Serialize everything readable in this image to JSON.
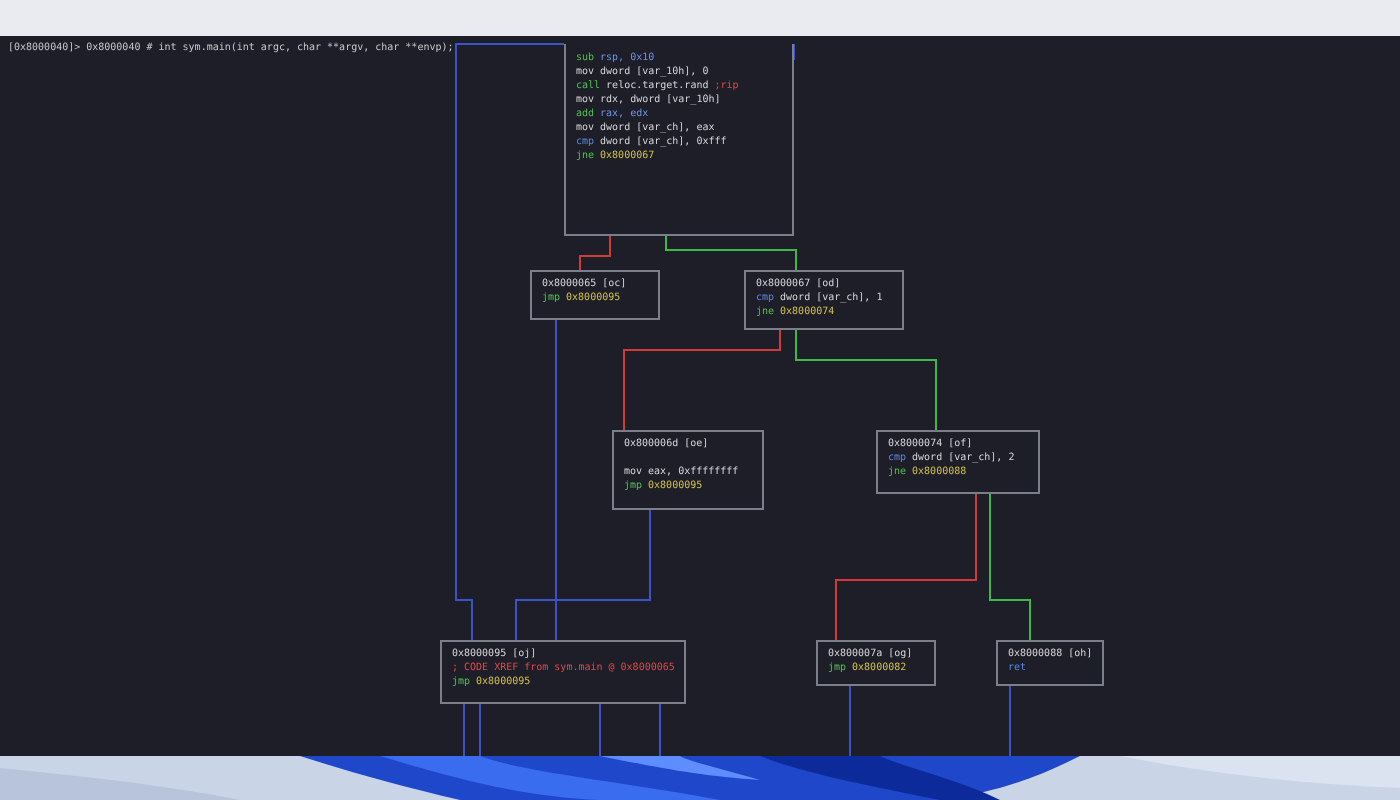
{
  "prompt": {
    "address": "[0x8000040]>",
    "text": "0x8000040 # int sym.main(int argc, char **argv, char **envp);"
  },
  "blocks": [
    {
      "lines": [
        {
          "kind": "arith",
          "op": "sub",
          "args": "rsp, 0x10"
        },
        {
          "kind": "mov",
          "op": "mov",
          "args": "dword [var_10h], 0"
        },
        {
          "kind": "call",
          "op": "call",
          "args": "reloc.target.rand",
          "note": ";rip"
        },
        {
          "kind": "mov",
          "op": "mov",
          "args": "rdx, dword [var_10h]"
        },
        {
          "kind": "arith",
          "op": "add",
          "args": "rax, edx"
        },
        {
          "kind": "mov",
          "op": "mov",
          "args": "dword [var_ch], eax"
        },
        {
          "kind": "cmp",
          "op": "cmp",
          "args": "dword [var_ch], 0xfff"
        },
        {
          "kind": "jump",
          "op": "jne",
          "args": "0x8000067"
        }
      ]
    },
    {
      "header": "0x8000065 [oc]",
      "lines": [
        {
          "kind": "jump",
          "op": "jmp",
          "args": "0x8000095"
        }
      ]
    },
    {
      "header": "0x8000067 [od]",
      "lines": [
        {
          "kind": "cmp",
          "op": "cmp",
          "args": "dword [var_ch], 1"
        },
        {
          "kind": "jump",
          "op": "jne",
          "args": "0x8000074"
        }
      ]
    },
    {
      "header": "0x800006d [oe]",
      "lines": [
        {
          "kind": "spacer"
        },
        {
          "kind": "mov",
          "op": "mov",
          "args": "eax, 0xffffffff"
        },
        {
          "kind": "jump",
          "op": "jmp",
          "args": "0x8000095"
        }
      ]
    },
    {
      "header": "0x8000074 [of]",
      "lines": [
        {
          "kind": "cmp",
          "op": "cmp",
          "args": "dword [var_ch], 2"
        },
        {
          "kind": "jump",
          "op": "jne",
          "args": "0x8000088"
        }
      ]
    },
    {
      "header": "0x8000095 [oj]",
      "lines": [
        {
          "kind": "comment",
          "args": "; CODE XREF from sym.main @ 0x8000065"
        },
        {
          "kind": "jump",
          "op": "jmp",
          "args": "0x8000095"
        }
      ]
    },
    {
      "header": "0x800007a [og]",
      "lines": [
        {
          "kind": "jump",
          "op": "jmp",
          "args": "0x8000082"
        }
      ]
    },
    {
      "header": "0x8000088 [oh]",
      "lines": [
        {
          "kind": "cmp",
          "op": "ret"
        }
      ]
    }
  ]
}
